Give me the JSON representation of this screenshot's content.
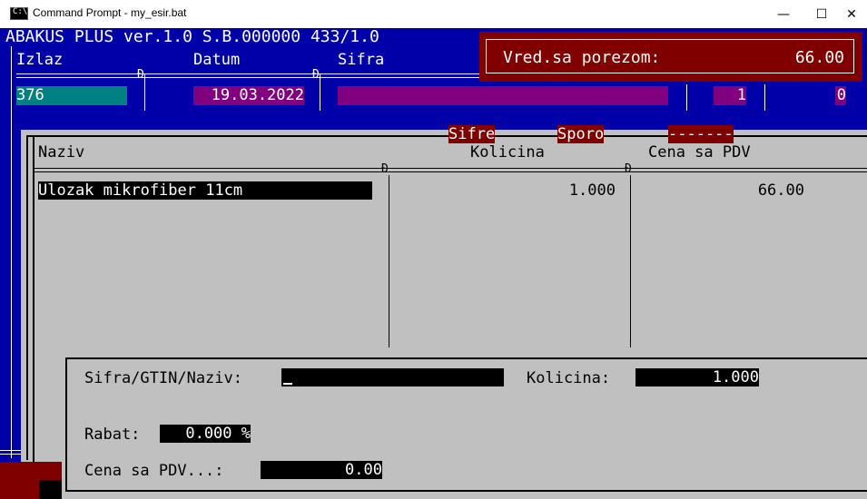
{
  "window": {
    "title": "Command Prompt - my_esir.bat",
    "icon_text": "C:\\",
    "minimize_glyph": "—",
    "maximize_glyph": "☐",
    "close_glyph": "✕"
  },
  "header": {
    "app_title": "ABAKUS PLUS ver.1.0 S.B.000000 433/1.0",
    "col_izlaz": "Izlaz",
    "col_datum": "Datum",
    "col_sifra": "Sifra",
    "izlaz_value": "376",
    "datum_value": "19.03.2022",
    "sifra_value": "",
    "field_a_value": "1",
    "field_b_value": "0",
    "sep_glyph": "Ð"
  },
  "total": {
    "label": "Vred.sa porezom:",
    "value": "66.00"
  },
  "tabs": {
    "sifre": "Sifre",
    "sporo": "Sporo",
    "dashes": "-------"
  },
  "table": {
    "columns": [
      "Naziv",
      "Kolicina",
      "Cena sa PDV"
    ],
    "rows": [
      {
        "naziv": "Ulozak mikrofiber 11cm",
        "kolicina": "1.000",
        "cena": "66.00"
      }
    ]
  },
  "form": {
    "sifra_label": "Sifra/GTIN/Naziv:",
    "sifra_value": "",
    "kolicina_label": "Kolicina:",
    "kolicina_value": "1.000",
    "rabat_label": "Rabat:",
    "rabat_value": "0.000 %",
    "cena_label": "Cena sa PDV...:",
    "cena_value": "0.00"
  },
  "colors": {
    "console_bg": "#c0c0c0",
    "navy": "#0000a8",
    "dark_red": "#800000",
    "cyan": "#008080",
    "purple": "#800080"
  }
}
